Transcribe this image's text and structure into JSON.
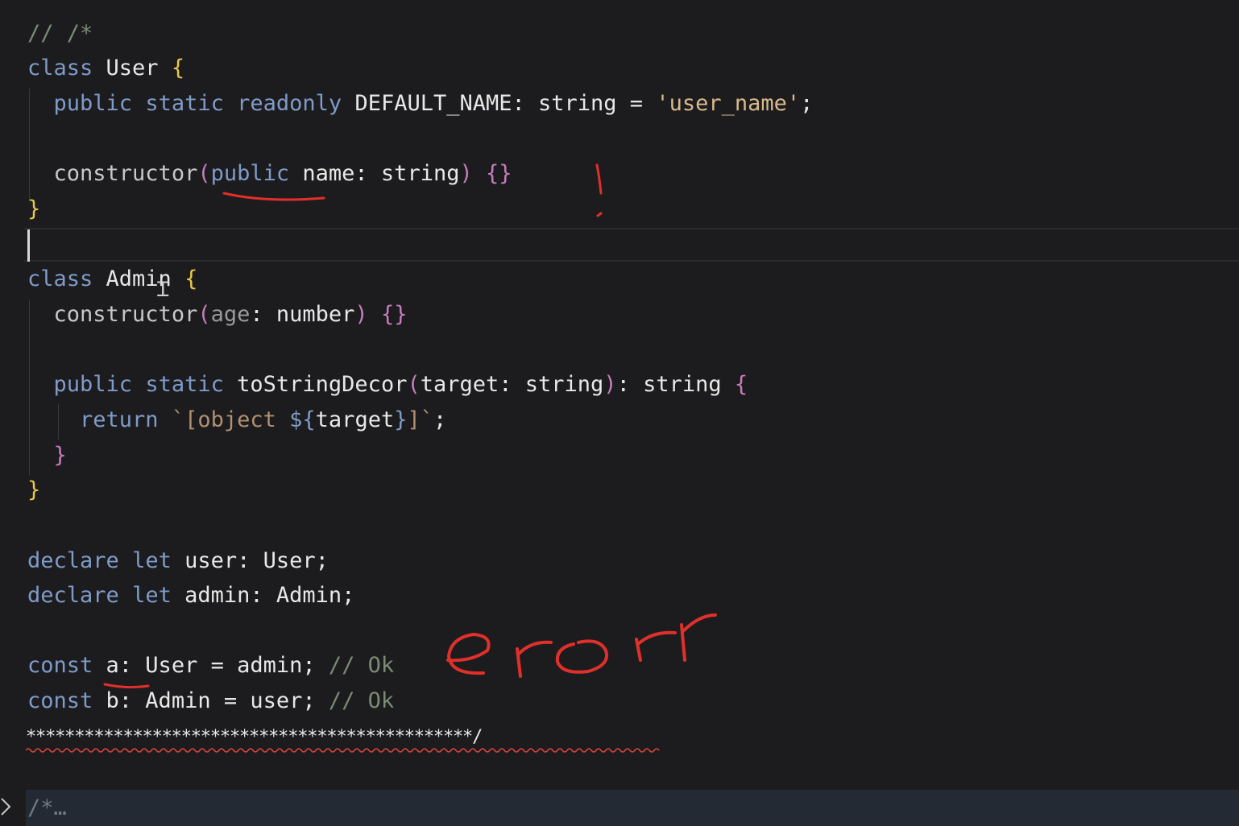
{
  "editor": {
    "lines": [
      {
        "id": "l1",
        "tokens": [
          {
            "t": "// /*",
            "c": "cm"
          }
        ]
      },
      {
        "id": "l2",
        "tokens": [
          {
            "t": "class",
            "c": "kw"
          },
          {
            "t": " User ",
            "c": "id"
          },
          {
            "t": "{",
            "c": "br1"
          }
        ]
      },
      {
        "id": "l3",
        "tokens": [
          {
            "t": "  ",
            "c": "id"
          },
          {
            "t": "public",
            "c": "kw"
          },
          {
            "t": " ",
            "c": "id"
          },
          {
            "t": "static",
            "c": "kw"
          },
          {
            "t": " ",
            "c": "id"
          },
          {
            "t": "readonly",
            "c": "kw"
          },
          {
            "t": " DEFAULT_NAME: string = ",
            "c": "id"
          },
          {
            "t": "'user_name'",
            "c": "str"
          },
          {
            "t": ";",
            "c": "punc"
          }
        ]
      },
      {
        "id": "l4",
        "tokens": []
      },
      {
        "id": "l5",
        "tokens": [
          {
            "t": "  ",
            "c": "id"
          },
          {
            "t": "constructor",
            "c": "fn"
          },
          {
            "t": "(",
            "c": "br2"
          },
          {
            "t": "public",
            "c": "kw"
          },
          {
            "t": " name: string",
            "c": "id"
          },
          {
            "t": ")",
            "c": "br2"
          },
          {
            "t": " ",
            "c": "id"
          },
          {
            "t": "{}",
            "c": "br2"
          }
        ]
      },
      {
        "id": "l6",
        "tokens": [
          {
            "t": "}",
            "c": "br1"
          }
        ]
      },
      {
        "id": "l7",
        "tokens": []
      },
      {
        "id": "l8",
        "tokens": [
          {
            "t": "class",
            "c": "kw"
          },
          {
            "t": " Admin ",
            "c": "id"
          },
          {
            "t": "{",
            "c": "br1"
          }
        ]
      },
      {
        "id": "l9",
        "tokens": [
          {
            "t": "  ",
            "c": "id"
          },
          {
            "t": "constructor",
            "c": "fn"
          },
          {
            "t": "(",
            "c": "br2"
          },
          {
            "t": "age",
            "c": "param"
          },
          {
            "t": ": number",
            "c": "id"
          },
          {
            "t": ")",
            "c": "br2"
          },
          {
            "t": " ",
            "c": "id"
          },
          {
            "t": "{}",
            "c": "br2"
          }
        ]
      },
      {
        "id": "l10",
        "tokens": []
      },
      {
        "id": "l11",
        "tokens": [
          {
            "t": "  ",
            "c": "id"
          },
          {
            "t": "public",
            "c": "kw"
          },
          {
            "t": " ",
            "c": "id"
          },
          {
            "t": "static",
            "c": "kw"
          },
          {
            "t": " toStringDecor",
            "c": "id"
          },
          {
            "t": "(",
            "c": "br2"
          },
          {
            "t": "target: string",
            "c": "id"
          },
          {
            "t": ")",
            "c": "br2"
          },
          {
            "t": ": string ",
            "c": "id"
          },
          {
            "t": "{",
            "c": "br2"
          }
        ]
      },
      {
        "id": "l12",
        "tokens": [
          {
            "t": "    ",
            "c": "id"
          },
          {
            "t": "return",
            "c": "kw"
          },
          {
            "t": " ",
            "c": "id"
          },
          {
            "t": "`[object ",
            "c": "tmpl"
          },
          {
            "t": "${",
            "c": "kw"
          },
          {
            "t": "target",
            "c": "id"
          },
          {
            "t": "}",
            "c": "kw"
          },
          {
            "t": "]`",
            "c": "tmpl"
          },
          {
            "t": ";",
            "c": "punc"
          }
        ]
      },
      {
        "id": "l13",
        "tokens": [
          {
            "t": "  ",
            "c": "id"
          },
          {
            "t": "}",
            "c": "br2"
          }
        ]
      },
      {
        "id": "l14",
        "tokens": [
          {
            "t": "}",
            "c": "br1"
          }
        ]
      },
      {
        "id": "l15",
        "tokens": []
      },
      {
        "id": "l16",
        "tokens": [
          {
            "t": "declare",
            "c": "kw"
          },
          {
            "t": " ",
            "c": "id"
          },
          {
            "t": "let",
            "c": "kw"
          },
          {
            "t": " user: User;",
            "c": "id"
          }
        ]
      },
      {
        "id": "l17",
        "tokens": [
          {
            "t": "declare",
            "c": "kw"
          },
          {
            "t": " ",
            "c": "id"
          },
          {
            "t": "let",
            "c": "kw"
          },
          {
            "t": " admin: Admin;",
            "c": "id"
          }
        ]
      },
      {
        "id": "l18",
        "tokens": []
      },
      {
        "id": "l19",
        "tokens": [
          {
            "t": "const",
            "c": "kw"
          },
          {
            "t": " a: User = admin; ",
            "c": "id"
          },
          {
            "t": "// Ok",
            "c": "cm"
          }
        ]
      },
      {
        "id": "l20",
        "tokens": [
          {
            "t": "const",
            "c": "kw"
          },
          {
            "t": " b: Admin = user; ",
            "c": "id"
          },
          {
            "t": "// Ok",
            "c": "cm"
          }
        ]
      }
    ],
    "stars_line": "**********************************************/",
    "folded_region": "/*…",
    "cursor_icon": "ibeam-cursor-icon",
    "fold_icon": "chevron-right-icon"
  },
  "annotations": {
    "handwritten_note": "erorr",
    "marks": [
      "underline-public",
      "exclamation-mark",
      "underline-a"
    ],
    "ink_color": "#e0302a"
  },
  "colors": {
    "background": "#1c1c1e",
    "keyword": "#7f9bc9",
    "string": "#d9b98c",
    "comment": "#7c8a76",
    "bracket_level1": "#e8c74a",
    "bracket_level2": "#c77dbd",
    "error_squiggle": "#d6453d"
  }
}
